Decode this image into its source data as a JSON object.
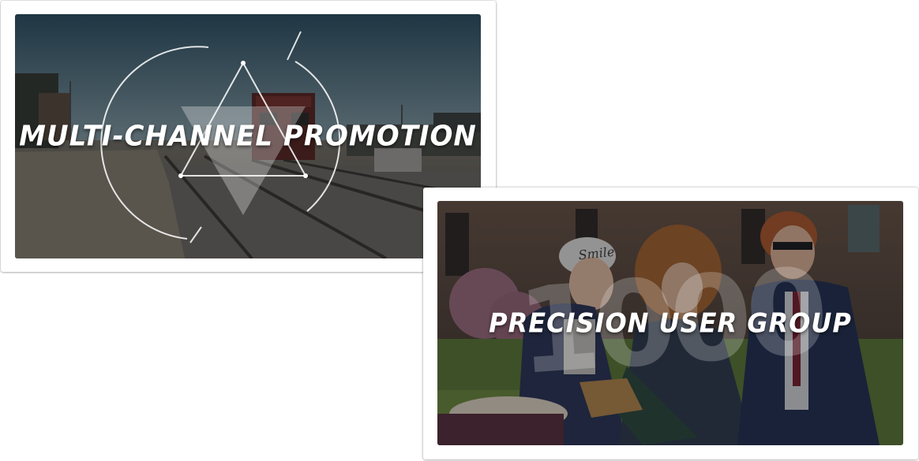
{
  "cards": [
    {
      "title": "MULTI-CHANNEL PROMOTION",
      "scene": "railway-tracks-photo",
      "overlay_icon": "triangle-in-circle-icon"
    },
    {
      "title": "PRECISION USER GROUP",
      "scene": "students-reading-on-grass-photo",
      "cap_text": "Smile",
      "ghost_digits": "1000"
    }
  ],
  "colors": {
    "overlay": "#0a0e14",
    "title": "#ffffff",
    "card_bg": "#ffffff"
  }
}
